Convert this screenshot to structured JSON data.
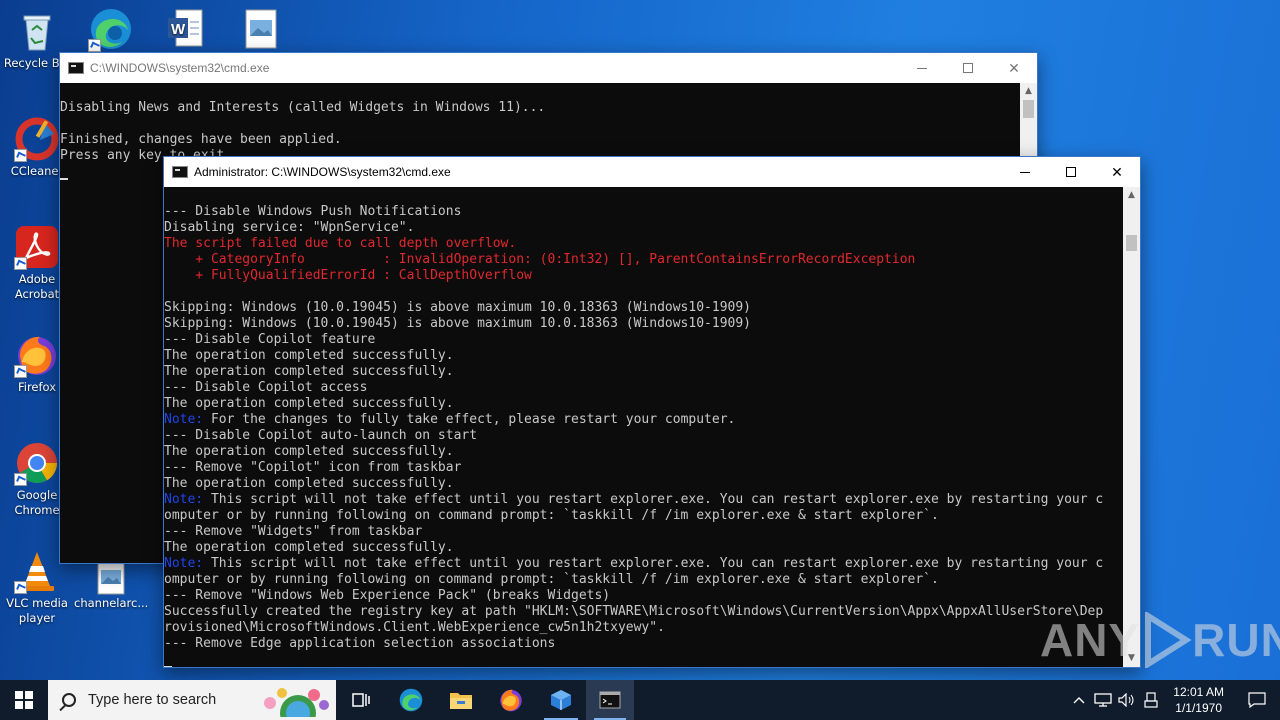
{
  "desktop": {
    "icons": [
      {
        "label": "Recycle Bin"
      },
      {
        "label": "CCleaner"
      },
      {
        "label": "Adobe Acrobat"
      },
      {
        "label": "Firefox"
      },
      {
        "label": "Google Chrome"
      },
      {
        "label": "VLC media player"
      },
      {
        "label": "channelarc..."
      }
    ]
  },
  "windows": {
    "back": {
      "title": "C:\\WINDOWS\\system32\\cmd.exe",
      "lines": [
        "",
        "Disabling News and Interests (called Widgets in Windows 11)...",
        "",
        "Finished, changes have been applied.",
        "Press any key to exit."
      ]
    },
    "front": {
      "title": "Administrator: C:\\WINDOWS\\system32\\cmd.exe",
      "lines": [
        "",
        "--- Disable Windows Push Notifications",
        "Disabling service: \"WpnService\".",
        "The script failed due to call depth overflow.",
        "    + CategoryInfo          : InvalidOperation: (0:Int32) [], ParentContainsErrorRecordException",
        "    + FullyQualifiedErrorId : CallDepthOverflow",
        "",
        "Skipping: Windows (10.0.19045) is above maximum 10.0.18363 (Windows10-1909)",
        "Skipping: Windows (10.0.19045) is above maximum 10.0.18363 (Windows10-1909)",
        "--- Disable Copilot feature",
        "The operation completed successfully.",
        "The operation completed successfully.",
        "--- Disable Copilot access",
        "The operation completed successfully.",
        "Note: For the changes to fully take effect, please restart your computer.",
        "--- Disable Copilot auto-launch on start",
        "The operation completed successfully.",
        "--- Remove \"Copilot\" icon from taskbar",
        "The operation completed successfully.",
        "Note: This script will not take effect until you restart explorer.exe. You can restart explorer.exe by restarting your c",
        "omputer or by running following on command prompt: `taskkill /f /im explorer.exe & start explorer`.",
        "--- Remove \"Widgets\" from taskbar",
        "The operation completed successfully.",
        "Note: This script will not take effect until you restart explorer.exe. You can restart explorer.exe by restarting your c",
        "omputer or by running following on command prompt: `taskkill /f /im explorer.exe & start explorer`.",
        "--- Remove \"Windows Web Experience Pack\" (breaks Widgets)",
        "Successfully created the registry key at path \"HKLM:\\SOFTWARE\\Microsoft\\Windows\\CurrentVersion\\Appx\\AppxAllUserStore\\Dep",
        "rovisioned\\MicrosoftWindows.Client.WebExperience_cw5n1h2txyewy\".",
        "--- Remove Edge application selection associations"
      ]
    }
  },
  "taskbar": {
    "search_placeholder": "Type here to search",
    "time": "12:01 AM",
    "date": "1/1/1970"
  },
  "watermark": {
    "text_left": "ANY",
    "text_right": "RUN"
  },
  "colors": {
    "error": "#e0282e",
    "note": "#1e45e8",
    "console_text": "#c8c8c8"
  }
}
